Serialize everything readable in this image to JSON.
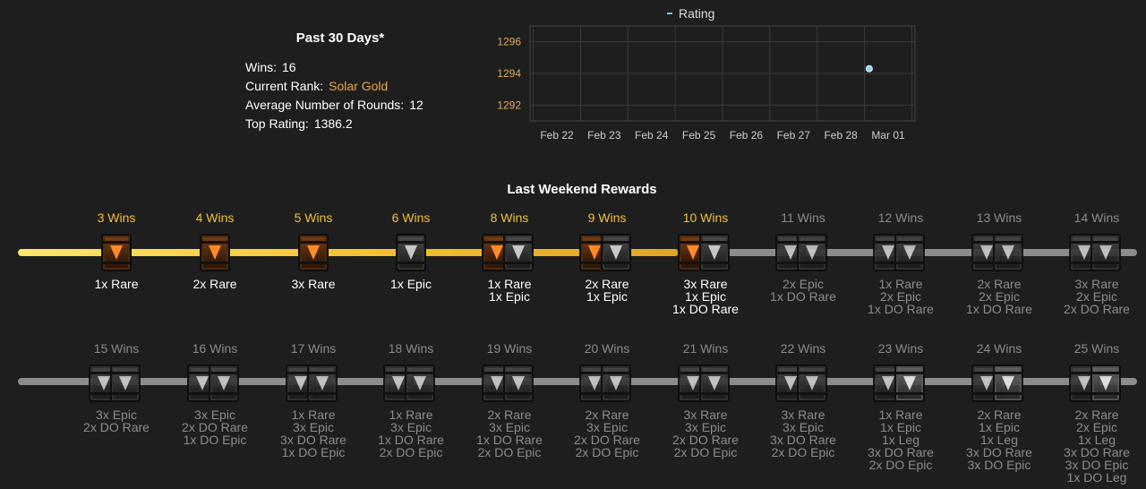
{
  "stats": {
    "title": "Past 30 Days*",
    "wins_label": "Wins:",
    "wins_value": "16",
    "rank_label": "Current Rank:",
    "rank_value": "Solar Gold",
    "rounds_label": "Average Number of Rounds:",
    "rounds_value": "12",
    "top_rating_label": "Top Rating:",
    "top_rating_value": "1386.2"
  },
  "chart_data": {
    "type": "scatter",
    "title": "",
    "xlabel": "",
    "ylabel": "",
    "legend": "top",
    "series": [
      {
        "name": "Rating",
        "color": "#8fd6f0",
        "points": [
          {
            "x": "Feb 28.6",
            "y": 1294.3
          }
        ]
      }
    ],
    "x_ticks": [
      "Feb 22",
      "Feb 23",
      "Feb 24",
      "Feb 25",
      "Feb 26",
      "Feb 27",
      "Feb 28",
      "Mar 01"
    ],
    "y_ticks": [
      1292,
      1294,
      1296
    ],
    "ylim": [
      1291,
      1297
    ],
    "grid": true
  },
  "rewards": {
    "title": "Last Weekend Rewards",
    "rows": [
      {
        "progress": 0.59,
        "nodes": [
          {
            "wins": "3 Wins",
            "achieved": true,
            "chests": [
              "rare"
            ],
            "lines": [
              "1x Rare"
            ]
          },
          {
            "wins": "4 Wins",
            "achieved": true,
            "chests": [
              "rare"
            ],
            "lines": [
              "2x Rare"
            ]
          },
          {
            "wins": "5 Wins",
            "achieved": true,
            "chests": [
              "rare"
            ],
            "lines": [
              "3x Rare"
            ]
          },
          {
            "wins": "6 Wins",
            "achieved": true,
            "chests": [
              "epic"
            ],
            "lines": [
              "1x Epic"
            ]
          },
          {
            "wins": "8 Wins",
            "achieved": true,
            "chests": [
              "rare",
              "epic"
            ],
            "lines": [
              "1x Rare",
              "1x Epic"
            ]
          },
          {
            "wins": "9 Wins",
            "achieved": true,
            "chests": [
              "rare",
              "epic"
            ],
            "lines": [
              "2x Rare",
              "1x Epic"
            ]
          },
          {
            "wins": "10 Wins",
            "achieved": true,
            "chests": [
              "rare",
              "epic"
            ],
            "lines": [
              "3x Rare",
              "1x Epic",
              "1x DO Rare"
            ]
          },
          {
            "wins": "11 Wins",
            "achieved": false,
            "chests": [
              "epic",
              "dorare"
            ],
            "lines": [
              "2x Epic",
              "1x DO Rare"
            ]
          },
          {
            "wins": "12 Wins",
            "achieved": false,
            "chests": [
              "epic",
              "dorare"
            ],
            "lines": [
              "1x Rare",
              "2x Epic",
              "1x DO Rare"
            ]
          },
          {
            "wins": "13 Wins",
            "achieved": false,
            "chests": [
              "epic",
              "dorare"
            ],
            "lines": [
              "2x Rare",
              "2x Epic",
              "1x DO Rare"
            ]
          },
          {
            "wins": "14 Wins",
            "achieved": false,
            "chests": [
              "epic",
              "dorare"
            ],
            "lines": [
              "3x Rare",
              "2x Epic",
              "2x DO Rare"
            ]
          }
        ]
      },
      {
        "progress": 0,
        "nodes": [
          {
            "wins": "15 Wins",
            "achieved": false,
            "chests": [
              "dorare",
              "epic"
            ],
            "lines": [
              "3x Epic",
              "2x DO Rare"
            ]
          },
          {
            "wins": "16 Wins",
            "achieved": false,
            "chests": [
              "dorare",
              "epic"
            ],
            "lines": [
              "3x Epic",
              "2x DO Rare",
              "1x DO Epic"
            ]
          },
          {
            "wins": "17 Wins",
            "achieved": false,
            "chests": [
              "dorare",
              "epic"
            ],
            "lines": [
              "1x Rare",
              "3x Epic",
              "3x DO Rare",
              "1x DO Epic"
            ]
          },
          {
            "wins": "18 Wins",
            "achieved": false,
            "chests": [
              "dorare",
              "epic"
            ],
            "lines": [
              "1x Rare",
              "3x Epic",
              "1x DO Rare",
              "2x DO Epic"
            ]
          },
          {
            "wins": "19 Wins",
            "achieved": false,
            "chests": [
              "dorare",
              "epic"
            ],
            "lines": [
              "2x Rare",
              "3x Epic",
              "1x DO Rare",
              "2x DO Epic"
            ]
          },
          {
            "wins": "20 Wins",
            "achieved": false,
            "chests": [
              "dorare",
              "epic"
            ],
            "lines": [
              "2x Rare",
              "3x Epic",
              "2x DO Rare",
              "2x DO Epic"
            ]
          },
          {
            "wins": "21 Wins",
            "achieved": false,
            "chests": [
              "dorare",
              "epic"
            ],
            "lines": [
              "3x Rare",
              "3x Epic",
              "2x DO Rare",
              "2x DO Epic"
            ]
          },
          {
            "wins": "22 Wins",
            "achieved": false,
            "chests": [
              "dorare",
              "epic"
            ],
            "lines": [
              "3x Rare",
              "3x Epic",
              "3x DO Rare",
              "2x DO Epic"
            ]
          },
          {
            "wins": "23 Wins",
            "achieved": false,
            "chests": [
              "dorare",
              "leg"
            ],
            "lines": [
              "1x Rare",
              "1x Epic",
              "1x Leg",
              "3x DO Rare",
              "2x DO Epic"
            ]
          },
          {
            "wins": "24 Wins",
            "achieved": false,
            "chests": [
              "dorare",
              "leg"
            ],
            "lines": [
              "2x Rare",
              "1x Epic",
              "1x Leg",
              "3x DO Rare",
              "3x DO Epic"
            ]
          },
          {
            "wins": "25 Wins",
            "achieved": false,
            "chests": [
              "dorare",
              "leg"
            ],
            "lines": [
              "2x Rare",
              "2x Epic",
              "1x Leg",
              "3x DO Rare",
              "3x DO Epic",
              "1x DO Leg"
            ]
          }
        ]
      }
    ]
  }
}
